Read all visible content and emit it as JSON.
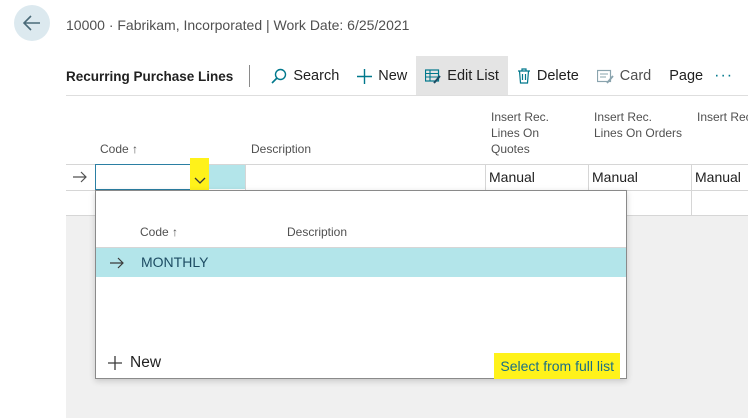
{
  "header": {
    "caption": "10000 · Fabrikam, Incorporated | Work Date: 6/25/2021",
    "back_icon": "back-arrow-icon"
  },
  "actionbar": {
    "title": "Recurring Purchase Lines",
    "search_label": "Search",
    "new_label": "New",
    "edit_list_label": "Edit List",
    "delete_label": "Delete",
    "card_label": "Card",
    "page_label": "Page",
    "more_label": "···"
  },
  "grid": {
    "columns": {
      "code": "Code ↑",
      "description": "Description",
      "quotes": "Insert Rec. Lines On Quotes",
      "orders": "Insert Rec. Lines On Orders",
      "invoices": "Insert Rec. Lines On Invoices"
    },
    "row": {
      "code": "",
      "description": "",
      "quotes": "Manual",
      "orders": "Manual",
      "invoices": "Manual"
    }
  },
  "dropdown": {
    "header_code": "Code ↑",
    "header_description": "Description",
    "rows": [
      {
        "code": "MONTHLY",
        "description": ""
      }
    ],
    "new_label": "New",
    "full_list_label": "Select from full list"
  },
  "colors": {
    "accent": "#00788c",
    "selection": "#b3e5ea",
    "highlight": "#fff21a"
  }
}
